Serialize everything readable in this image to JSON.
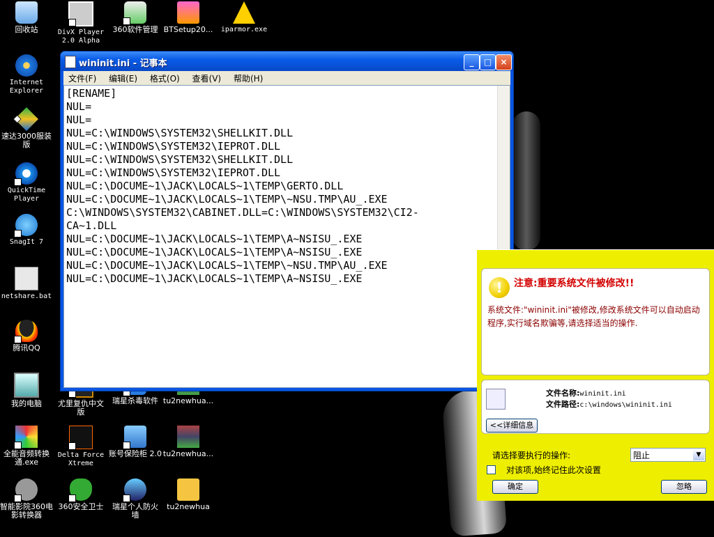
{
  "desktop": {
    "icons": [
      {
        "label": "回收站",
        "glyph": "g-bin"
      },
      {
        "label": "DivX Player 2.0 Alpha",
        "glyph": "g-divx"
      },
      {
        "label": "360软件管理",
        "glyph": "g-360"
      },
      {
        "label": "BTSetup20...",
        "glyph": "g-bt"
      },
      {
        "label": "iparmor.exe",
        "glyph": "g-armor"
      },
      {
        "label": "Internet Explorer",
        "glyph": "g-ie"
      },
      {
        "label": "速达3000服装版",
        "glyph": "g-speed"
      },
      {
        "label": "QuickTime Player",
        "glyph": "g-qt"
      },
      {
        "label": "SnagIt 7",
        "glyph": "g-snag"
      },
      {
        "label": "netshare.bat",
        "glyph": "g-bat"
      },
      {
        "label": "腾讯QQ",
        "glyph": "g-qq"
      },
      {
        "label": "我的电脑",
        "glyph": "g-pc"
      },
      {
        "label": "尤里复仇中文版",
        "glyph": "g-game"
      },
      {
        "label": "瑞星杀毒软件",
        "glyph": "g-virus"
      },
      {
        "label": "tu2newhua...",
        "glyph": "g-rar"
      },
      {
        "label": "全能音频转换通.exe",
        "glyph": "g-media"
      },
      {
        "label": "Delta Force Xtreme",
        "glyph": "g-df"
      },
      {
        "label": "账号保险柜 2.0",
        "glyph": "g-vault"
      },
      {
        "label": "tu2newhua...",
        "glyph": "g-rar"
      },
      {
        "label": "智能影院360电影转换器",
        "glyph": "g-smart"
      },
      {
        "label": "360安全卫士",
        "glyph": "g-shield"
      },
      {
        "label": "瑞星个人防火墙",
        "glyph": "g-wall"
      },
      {
        "label": "tu2newhua",
        "glyph": "g-folder"
      }
    ]
  },
  "notepad": {
    "title": "wininit.ini - 记事本",
    "menu": [
      "文件(F)",
      "编辑(E)",
      "格式(O)",
      "查看(V)",
      "帮助(H)"
    ],
    "content": "[RENAME]\nNUL=\nNUL=\nNUL=C:\\WINDOWS\\SYSTEM32\\SHELLKIT.DLL\nNUL=C:\\WINDOWS\\SYSTEM32\\IEPROT.DLL\nNUL=C:\\WINDOWS\\SYSTEM32\\SHELLKIT.DLL\nNUL=C:\\WINDOWS\\SYSTEM32\\IEPROT.DLL\nNUL=C:\\DOCUME~1\\JACK\\LOCALS~1\\TEMP\\GERTO.DLL\nNUL=C:\\DOCUME~1\\JACK\\LOCALS~1\\TEMP\\~NSU.TMP\\AU_.EXE\nC:\\WINDOWS\\SYSTEM32\\CABINET.DLL=C:\\WINDOWS\\SYSTEM32\\CI2-\nCA~1.DLL\nNUL=C:\\DOCUME~1\\JACK\\LOCALS~1\\TEMP\\A~NSISU_.EXE\nNUL=C:\\DOCUME~1\\JACK\\LOCALS~1\\TEMP\\A~NSISU_.EXE\nNUL=C:\\DOCUME~1\\JACK\\LOCALS~1\\TEMP\\~NSU.TMP\\AU_.EXE\nNUL=C:\\DOCUME~1\\JACK\\LOCALS~1\\TEMP\\A~NSISU_.EXE"
  },
  "alert": {
    "title": "注意:重要系统文件被修改!!",
    "body": "系统文件:\"wininit.ini\"被修改,修改系统文件可以自动启动程序,实行域名欺骗等,请选择适当的操作.",
    "file_name_label": "文件名称:",
    "file_name_value": "wininit.ini",
    "file_path_label": "文件路径:",
    "file_path_value": "c:\\windows\\wininit.ini",
    "details_button": "<<详细信息",
    "action_label": "请选择要执行的操作:",
    "action_value": "阻止",
    "remember_label": "对该项,始终记住此次设置",
    "ok_button": "确定",
    "ignore_button": "忽略"
  }
}
